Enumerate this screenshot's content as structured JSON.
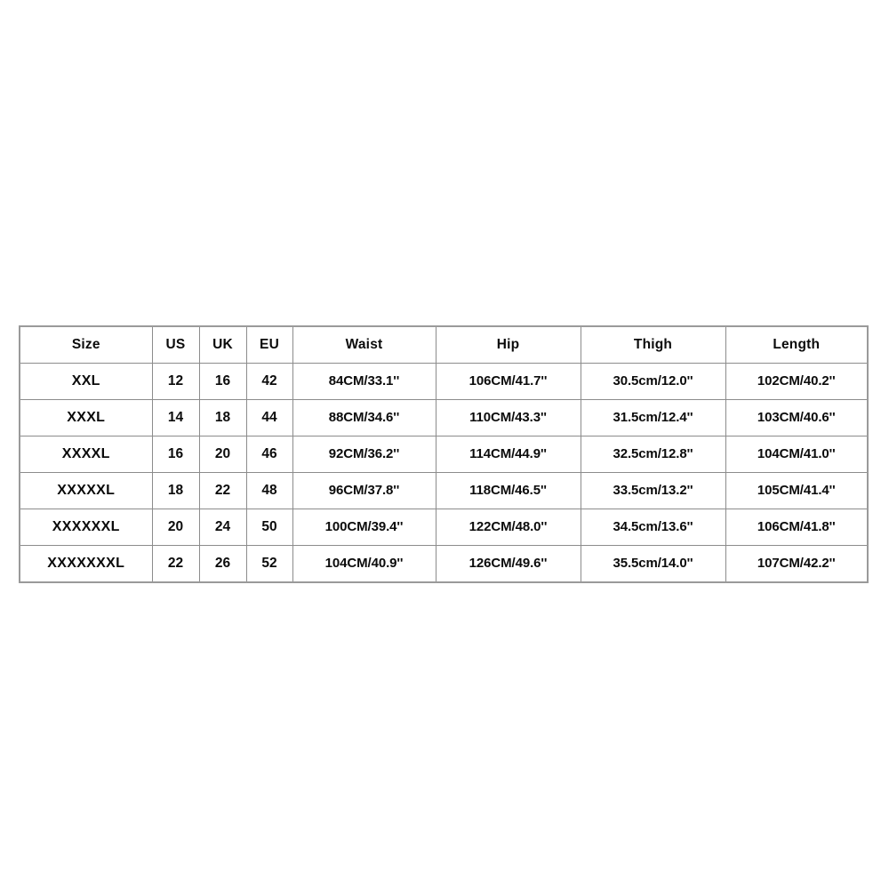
{
  "chart_data": {
    "type": "table",
    "title": "",
    "columns": [
      "Size",
      "US",
      "UK",
      "EU",
      "Waist",
      "Hip",
      "Thigh",
      "Length"
    ],
    "rows": [
      [
        "XXL",
        "12",
        "16",
        "42",
        "84CM/33.1''",
        "106CM/41.7''",
        "30.5cm/12.0''",
        "102CM/40.2''"
      ],
      [
        "XXXL",
        "14",
        "18",
        "44",
        "88CM/34.6''",
        "110CM/43.3''",
        "31.5cm/12.4''",
        "103CM/40.6''"
      ],
      [
        "XXXXL",
        "16",
        "20",
        "46",
        "92CM/36.2''",
        "114CM/44.9''",
        "32.5cm/12.8''",
        "104CM/41.0''"
      ],
      [
        "XXXXXL",
        "18",
        "22",
        "48",
        "96CM/37.8''",
        "118CM/46.5''",
        "33.5cm/13.2''",
        "105CM/41.4''"
      ],
      [
        "XXXXXXL",
        "20",
        "24",
        "50",
        "100CM/39.4''",
        "122CM/48.0''",
        "34.5cm/13.6''",
        "106CM/41.8''"
      ],
      [
        "XXXXXXXL",
        "22",
        "26",
        "52",
        "104CM/40.9''",
        "126CM/49.6''",
        "35.5cm/14.0''",
        "107CM/42.2''"
      ]
    ]
  },
  "size_chart": {
    "headers": {
      "size": "Size",
      "us": "US",
      "uk": "UK",
      "eu": "EU",
      "waist": "Waist",
      "hip": "Hip",
      "thigh": "Thigh",
      "length": "Length"
    },
    "rows": [
      {
        "size": "XXL",
        "us": "12",
        "uk": "16",
        "eu": "42",
        "waist": "84CM/33.1''",
        "hip": "106CM/41.7''",
        "thigh": "30.5cm/12.0''",
        "length": "102CM/40.2''"
      },
      {
        "size": "XXXL",
        "us": "14",
        "uk": "18",
        "eu": "44",
        "waist": "88CM/34.6''",
        "hip": "110CM/43.3''",
        "thigh": "31.5cm/12.4''",
        "length": "103CM/40.6''"
      },
      {
        "size": "XXXXL",
        "us": "16",
        "uk": "20",
        "eu": "46",
        "waist": "92CM/36.2''",
        "hip": "114CM/44.9''",
        "thigh": "32.5cm/12.8''",
        "length": "104CM/41.0''"
      },
      {
        "size": "XXXXXL",
        "us": "18",
        "uk": "22",
        "eu": "48",
        "waist": "96CM/37.8''",
        "hip": "118CM/46.5''",
        "thigh": "33.5cm/13.2''",
        "length": "105CM/41.4''"
      },
      {
        "size": "XXXXXXL",
        "us": "20",
        "uk": "24",
        "eu": "50",
        "waist": "100CM/39.4''",
        "hip": "122CM/48.0''",
        "thigh": "34.5cm/13.6''",
        "length": "106CM/41.8''"
      },
      {
        "size": "XXXXXXXL",
        "us": "22",
        "uk": "26",
        "eu": "52",
        "waist": "104CM/40.9''",
        "hip": "126CM/49.6''",
        "thigh": "35.5cm/14.0''",
        "length": "107CM/42.2''"
      }
    ]
  },
  "colors": {
    "background": "#ffffff",
    "text": "#0b0b0b",
    "grid_line": "#8c8c8c",
    "outer_border": "#9a9a9a"
  }
}
